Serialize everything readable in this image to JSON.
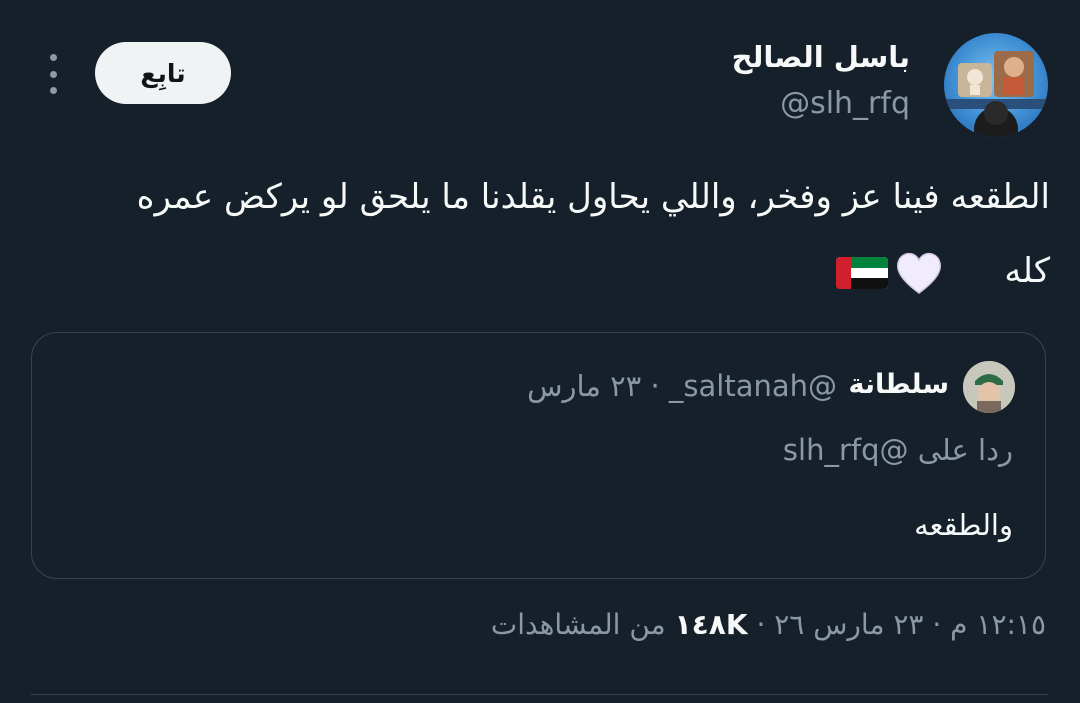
{
  "author": {
    "name": "باسل الصالح",
    "handle": "@slh_rfq"
  },
  "follow_label": "تابِع",
  "tweet": {
    "line1": "الطقعه فينا عز وفخر، واللي يحاول يقلدنا ما يلحق لو يركض عمره",
    "line2": "كله",
    "emojis": [
      "white-heart-icon",
      "uae-flag-icon"
    ]
  },
  "quote": {
    "name": "سلطانة",
    "handle": "@saltanah_",
    "separator": "·",
    "date": "٢٣ مارس",
    "reply_prefix": "ردا على",
    "reply_handle": "@slh_rfq",
    "text": "والطقعه"
  },
  "footer": {
    "time": "١٢:١٥ م",
    "date": "٢٣ مارس ٢٦",
    "separator": "·",
    "views": "١٤٨K",
    "views_label": "من المشاهدات"
  },
  "colors": {
    "background": "#15202b",
    "text": "#f7f9f9",
    "muted": "#8b98a5",
    "border": "#38444d"
  }
}
